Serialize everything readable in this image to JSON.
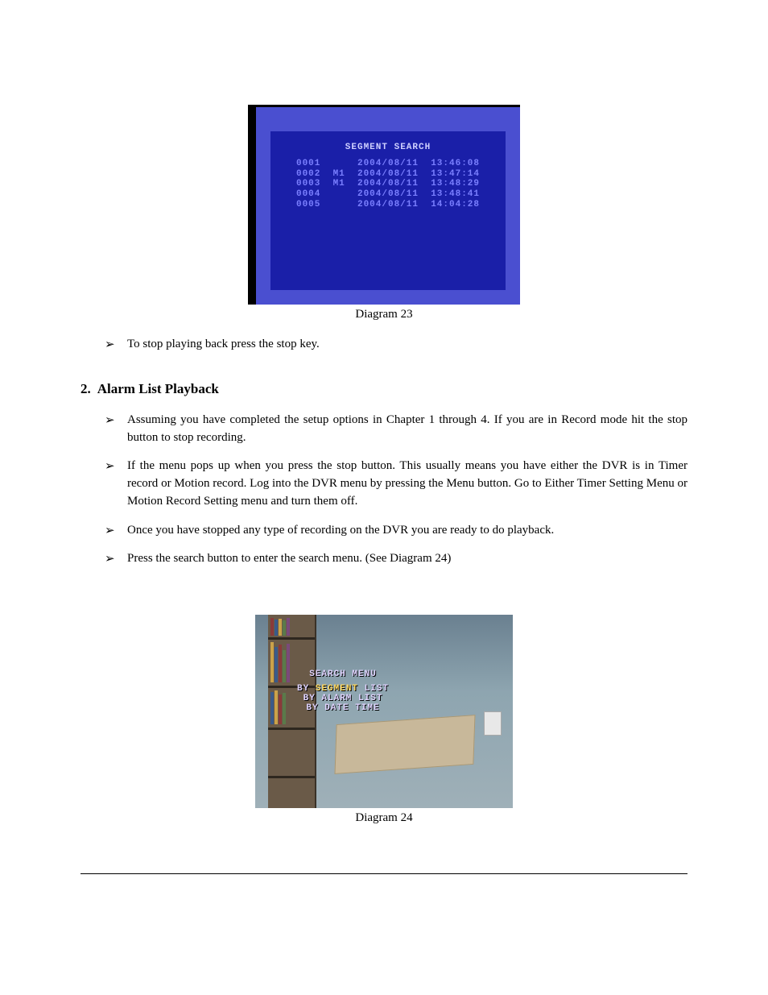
{
  "diagram23": {
    "title": "SEGMENT SEARCH",
    "rows": [
      {
        "id": "0001",
        "flag": "  ",
        "date": "2004/08/11",
        "time": "13:46:08"
      },
      {
        "id": "0002",
        "flag": "M1",
        "date": "2004/08/11",
        "time": "13:47:14"
      },
      {
        "id": "0003",
        "flag": "M1",
        "date": "2004/08/11",
        "time": "13:48:29"
      },
      {
        "id": "0004",
        "flag": "  ",
        "date": "2004/08/11",
        "time": "13:48:41"
      },
      {
        "id": "0005",
        "flag": "  ",
        "date": "2004/08/11",
        "time": "14:04:28"
      }
    ],
    "caption": "Diagram 23"
  },
  "bullets_top": [
    "To stop playing back press the stop key."
  ],
  "section": {
    "number": "2.",
    "title": "Alarm List Playback"
  },
  "bullets_section": [
    "Assuming you have completed the setup options in Chapter 1 through 4. If you are in Record mode hit the stop button to stop recording.",
    "If the menu pops up when you press the stop button. This usually means you have either the DVR is in Timer record or Motion record. Log into the DVR menu by pressing the Menu button. Go to Either Timer Setting Menu or Motion Record Setting menu and turn them off.",
    "Once you have stopped any type of recording on the DVR you are ready to do playback.",
    "Press the search button to enter the search menu. (See Diagram 24)"
  ],
  "diagram24": {
    "osd_title": "SEARCH MENU",
    "lines": [
      {
        "by": "BY ",
        "sel": "SEGMENT ",
        "rest": "LIST"
      },
      {
        "by": "BY ",
        "sel": "",
        "rest": "ALARM LIST"
      },
      {
        "by": "BY ",
        "sel": "",
        "rest": "DATE TIME"
      }
    ],
    "caption": "Diagram 24"
  },
  "arrow": "➢"
}
